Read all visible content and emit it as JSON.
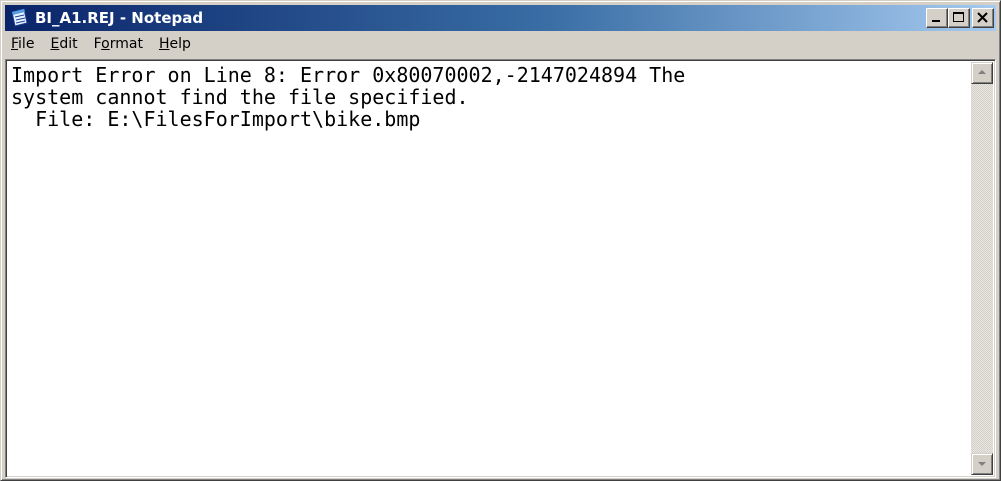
{
  "window": {
    "title": "BI_A1.REJ - Notepad",
    "icon": "notepad-icon"
  },
  "title_buttons": {
    "minimize_icon": "minimize-icon",
    "maximize_icon": "maximize-icon",
    "close_icon": "close-icon"
  },
  "menu": {
    "file": {
      "pre": "",
      "key": "F",
      "post": "ile"
    },
    "edit": {
      "pre": "",
      "key": "E",
      "post": "dit"
    },
    "format": {
      "pre": "F",
      "key": "o",
      "post": "rmat"
    },
    "help": {
      "pre": "",
      "key": "H",
      "post": "elp"
    }
  },
  "editor": {
    "content": "Import Error on Line 8: Error 0x80070002,-2147024894 The\nsystem cannot find the file specified.\n  File: E:\\FilesForImport\\bike.bmp"
  },
  "scrollbar": {
    "up_icon": "scroll-up-arrow-icon",
    "down_icon": "scroll-down-arrow-icon"
  },
  "colors": {
    "title_gradient_start": "#0a246a",
    "title_gradient_end": "#a6caf0",
    "face": "#d4d0c8",
    "text_background": "#ffffff"
  }
}
